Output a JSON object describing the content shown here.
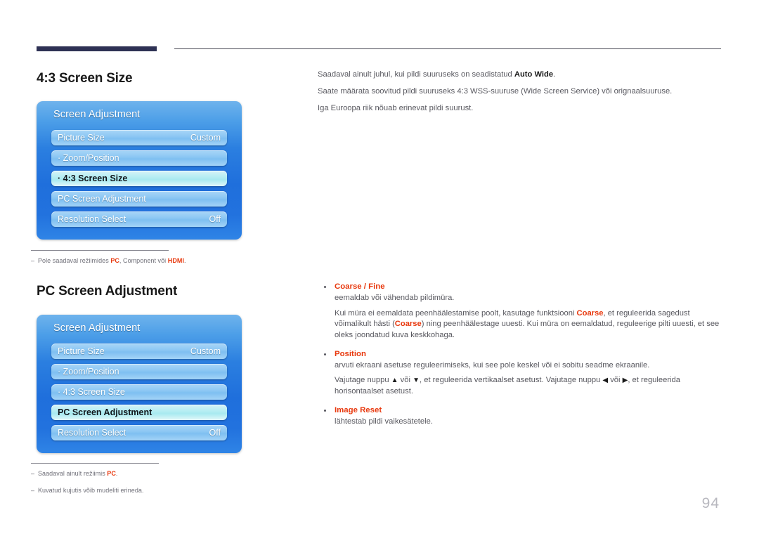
{
  "page": {
    "number": "94"
  },
  "sections": [
    {
      "heading": "4:3 Screen Size",
      "osd": {
        "title": "Screen Adjustment",
        "rows": [
          {
            "label": "Picture Size",
            "value": "Custom",
            "selected": false
          },
          {
            "label": "· Zoom/Position",
            "value": "",
            "selected": false
          },
          {
            "label": "· 4:3 Screen Size",
            "value": "",
            "selected": true
          },
          {
            "label": "PC Screen Adjustment",
            "value": "",
            "selected": false
          },
          {
            "label": "Resolution Select",
            "value": "Off",
            "selected": false
          }
        ]
      }
    },
    {
      "heading": "PC Screen Adjustment",
      "osd": {
        "title": "Screen Adjustment",
        "rows": [
          {
            "label": "Picture Size",
            "value": "Custom",
            "selected": false
          },
          {
            "label": "· Zoom/Position",
            "value": "",
            "selected": false
          },
          {
            "label": "· 4:3 Screen Size",
            "value": "",
            "selected": false
          },
          {
            "label": "PC Screen Adjustment",
            "value": "",
            "selected": true
          },
          {
            "label": "Resolution Select",
            "value": "Off",
            "selected": false
          }
        ]
      }
    }
  ],
  "intro": {
    "line1_a": "Saadaval ainult juhul, kui pildi suuruseks on seadistatud ",
    "line1_b": "Auto Wide",
    "line1_c": ".",
    "line2": "Saate määrata soovitud pildi suuruseks 4:3 WSS-suuruse (Wide Screen Service) või orignaalsuuruse.",
    "line3": "Iga Euroopa riik nõuab erinevat pildi suurust."
  },
  "footnotes": {
    "f1_a": "Pole saadaval režiimides ",
    "f1_b": "PC",
    "f1_c": ", Component või ",
    "f1_d": "HDMI",
    "f1_e": ".",
    "f2_a": "Saadaval ainult režiimis ",
    "f2_b": "PC",
    "f2_c": ".",
    "f3": "Kuvatud kujutis võib mudeliti erineda."
  },
  "bullets": [
    {
      "title": "Coarse / Fine",
      "p1": "eemaldab või vähendab pildimüra.",
      "p2_a": "Kui müra ei eemaldata peenhäälestamise poolt, kasutage funktsiooni ",
      "p2_b": "Coarse",
      "p2_c": ", et reguleerida sagedust võimalikult hästi (",
      "p2_d": "Coarse",
      "p2_e": ") ning peenhäälestage uuesti. Kui müra on eemaldatud, reguleerige pilti uuesti, et see oleks joondatud kuva keskkohaga."
    },
    {
      "title": "Position",
      "p1": "arvuti ekraani asetuse reguleerimiseks, kui see pole keskel või ei sobitu seadme ekraanile.",
      "p2_a": "Vajutage nuppu ",
      "p2_arrow_up": "▲",
      "p2_b": " või ",
      "p2_arrow_down": "▼",
      "p2_c": ", et reguleerida vertikaalset asetust. Vajutage nuppu ",
      "p2_arrow_left": "◀",
      "p2_d": " või ",
      "p2_arrow_right": "▶",
      "p2_e": ", et reguleerida horisontaalset asetust."
    },
    {
      "title": "Image Reset",
      "p1": "lähtestab pildi vaikesätetele."
    }
  ],
  "colors": {
    "accent_red": "#e8380d",
    "rule_navy": "#2e3154",
    "body_text": "#58585f",
    "osd_blue": "#1f6fdc",
    "osd_selected": "#b6eef3"
  }
}
